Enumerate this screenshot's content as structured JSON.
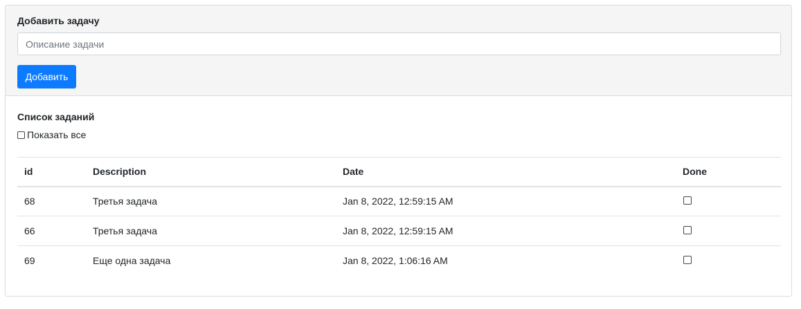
{
  "add_section": {
    "title": "Добавить задачу",
    "input_placeholder": "Описание задачи",
    "input_value": "",
    "button_label": "Добавить"
  },
  "list_section": {
    "title": "Список заданий",
    "show_all_label": "Показать все",
    "show_all_checked": false
  },
  "table": {
    "headers": {
      "id": "id",
      "description": "Description",
      "date": "Date",
      "done": "Done"
    },
    "rows": [
      {
        "id": "68",
        "description": "Третья задача",
        "date": "Jan 8, 2022, 12:59:15 AM",
        "done": false
      },
      {
        "id": "66",
        "description": "Третья задача",
        "date": "Jan 8, 2022, 12:59:15 AM",
        "done": false
      },
      {
        "id": "69",
        "description": "Еще одна задача",
        "date": "Jan 8, 2022, 1:06:16 AM",
        "done": false
      }
    ]
  },
  "colors": {
    "primary_button": "#0d7bff",
    "top_panel_background": "#f5f5f5"
  }
}
